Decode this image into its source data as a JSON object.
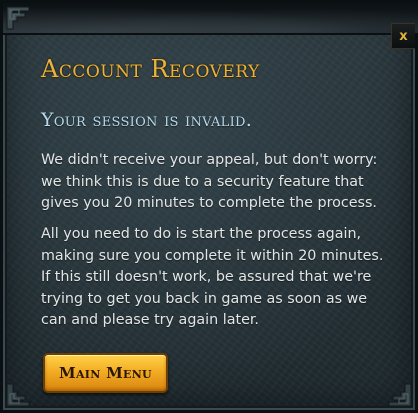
{
  "dialog": {
    "title": "Account Recovery",
    "subtitle": "Your session is invalid.",
    "paragraphs": [
      "We didn't receive your appeal, but don't worry: we think this is due to a security feature that gives you 20 minutes to complete the process.",
      "All you need to do is start the process again, making sure you complete it within 20 minutes. If this still doesn't work, be assured that we're trying to get you back in game as soon as we can and please try again later."
    ],
    "close_label": "x",
    "main_menu_label": "Main Menu"
  },
  "colors": {
    "title": "#e9b33a",
    "subtitle": "#b6d9ec",
    "body_text": "#e3e6e6",
    "button_gold": "#f3ad24",
    "panel_bg": "#27343a"
  },
  "icons": {
    "close": "close-icon",
    "corner": "ornament-corner-icon"
  }
}
